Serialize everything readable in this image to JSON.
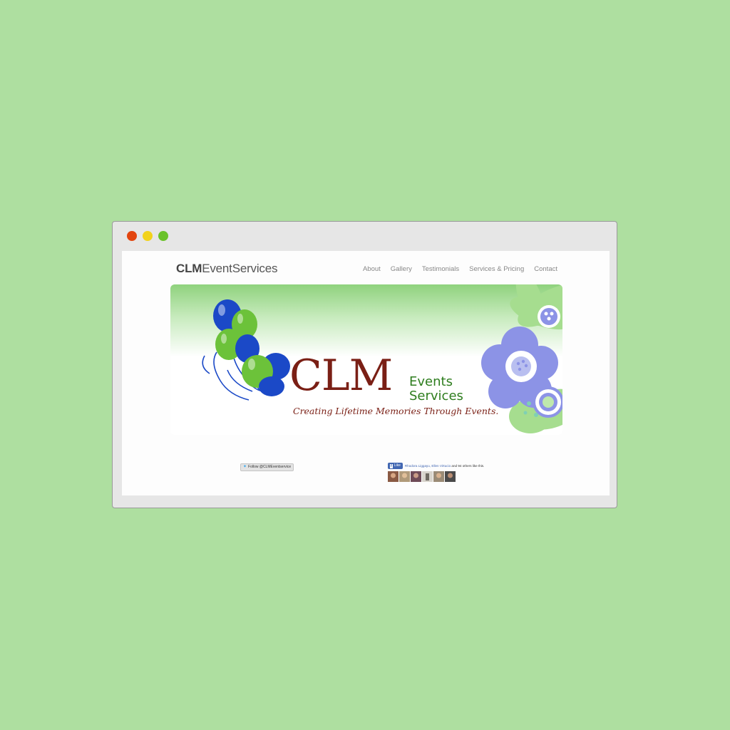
{
  "window": {
    "controls": [
      "close",
      "minimize",
      "maximize"
    ]
  },
  "header": {
    "brand_bold": "CLM",
    "brand_light": "EventServices",
    "nav": [
      "About",
      "Gallery",
      "Testimonials",
      "Services & Pricing",
      "Contact"
    ]
  },
  "banner": {
    "logo_main": "CLM",
    "logo_line1": "Events",
    "logo_line2": "Services",
    "tagline": "Creating Lifetime Memories Through Events."
  },
  "social": {
    "twitter_label": "Follow @CLMEventservice",
    "fb_like_label": "Like",
    "fb_names": "Rhodora Liggayu, Ellen Virtucio",
    "fb_rest": " and 94 others like this."
  },
  "colors": {
    "background": "#aedfa0",
    "brand_red": "#7a1f15",
    "brand_green": "#2e7d1e",
    "balloon_blue": "#1b49c7",
    "balloon_green": "#6cc23a",
    "flower_lavender": "#8c93e6"
  }
}
